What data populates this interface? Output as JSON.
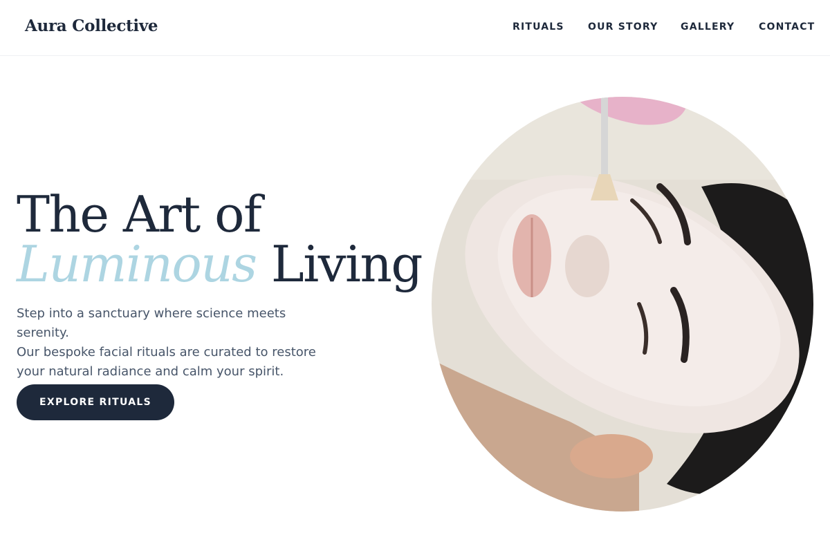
{
  "brand": {
    "name": "Aura Collective"
  },
  "nav": {
    "items": [
      "RITUALS",
      "OUR STORY",
      "GALLERY",
      "CONTACT"
    ]
  },
  "hero": {
    "headline_line1": "The Art of",
    "headline_accent": "Luminous",
    "headline_line2_rest": "Living",
    "body_line1": "Step into a sanctuary where science meets serenity.",
    "body_line2": "Our bespoke facial rituals are curated to restore",
    "body_line3": "your natural radiance and calm your spirit.",
    "cta_label": "EXPLORE RITUALS",
    "image": "facial-mask-treatment-photo"
  },
  "colors": {
    "primary": "#1e293b",
    "accent": "#add5e2",
    "body_text": "#475569",
    "background": "#ffffff"
  }
}
